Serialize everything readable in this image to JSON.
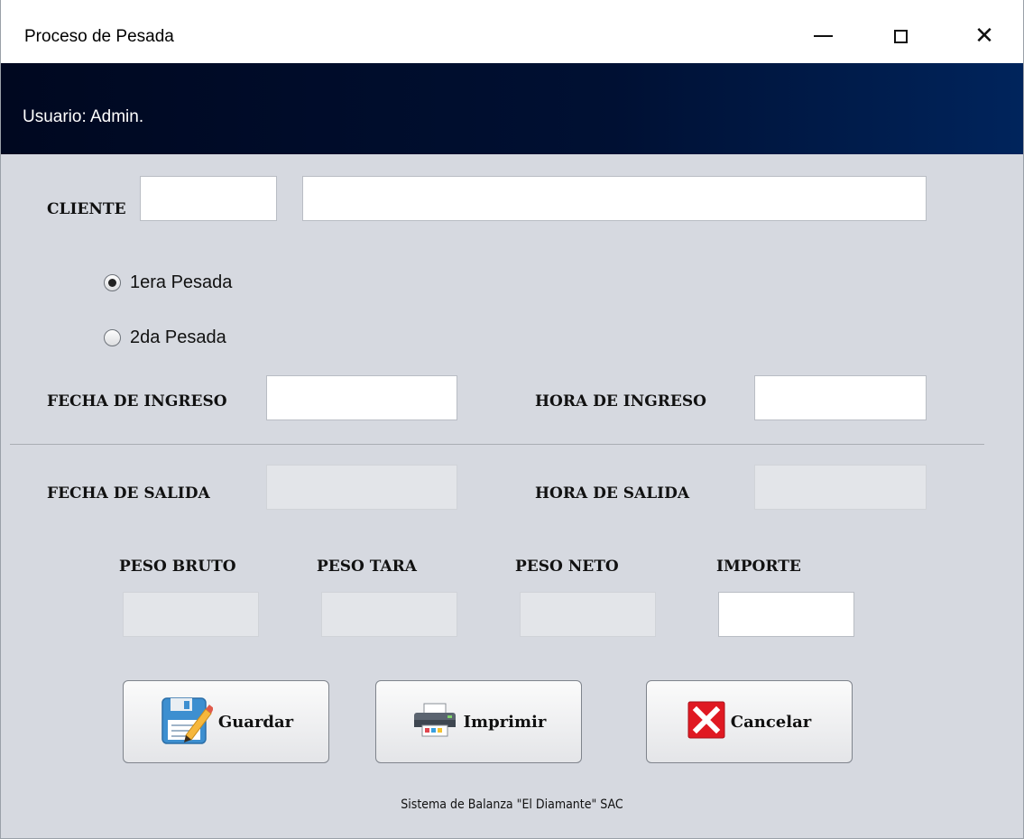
{
  "window": {
    "title": "Proceso de Pesada",
    "minimize_icon": "minimize-icon",
    "maximize_icon": "maximize-icon",
    "close_icon": "close-icon"
  },
  "banner": {
    "user_text": "Usuario: Admin."
  },
  "form": {
    "cliente_label": "CLIENTE",
    "cliente_code": "",
    "cliente_name": "",
    "radio_primera": "1era Pesada",
    "radio_segunda": "2da Pesada",
    "selected_radio": "1era Pesada",
    "fecha_ingreso_label": "FECHA DE INGRESO",
    "fecha_ingreso": "",
    "hora_ingreso_label": "HORA DE INGRESO",
    "hora_ingreso": "",
    "fecha_salida_label": "FECHA DE SALIDA",
    "fecha_salida": "",
    "hora_salida_label": "HORA DE SALIDA",
    "hora_salida": "",
    "peso_bruto_label": "PESO BRUTO",
    "peso_bruto": "",
    "peso_tara_label": "PESO TARA",
    "peso_tara": "",
    "peso_neto_label": "PESO NETO",
    "peso_neto": "",
    "importe_label": "IMPORTE",
    "importe": ""
  },
  "buttons": {
    "guardar": "Guardar",
    "imprimir": "Imprimir",
    "cancelar": "Cancelar"
  },
  "footer": "Sistema de Balanza \"El Diamante\" SAC",
  "colors": {
    "banner": "#001033",
    "background": "#d6d9e0",
    "cancel_red": "#e01922"
  }
}
